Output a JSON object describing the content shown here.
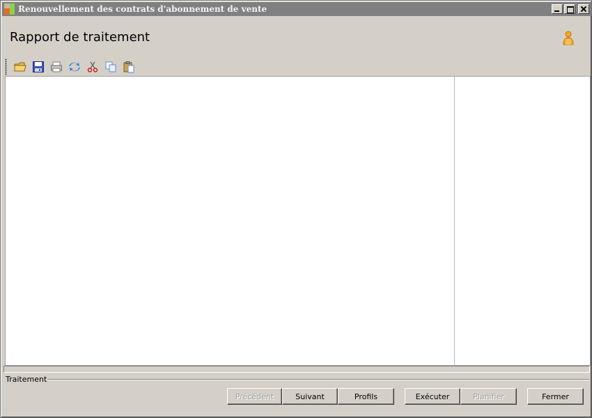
{
  "window": {
    "title": "Renouvellement des contrats d'abonnement de vente"
  },
  "header": {
    "title": "Rapport de traitement"
  },
  "toolbar": {
    "icons": [
      "open-folder-icon",
      "save-icon",
      "print-icon",
      "refresh-icon",
      "cut-icon",
      "copy-icon",
      "paste-icon"
    ]
  },
  "group": {
    "label": "Traitement"
  },
  "buttons": {
    "previous": {
      "label": "Précédent",
      "enabled": false
    },
    "next": {
      "label": "Suivant",
      "enabled": true
    },
    "profiles": {
      "label": "Profils",
      "enabled": true
    },
    "execute": {
      "label": "Exécuter",
      "enabled": true
    },
    "schedule": {
      "label": "Planifier",
      "enabled": false
    },
    "close": {
      "label": "Fermer",
      "enabled": true
    }
  },
  "colors": {
    "titlebar": "#808080",
    "window_bg": "#d4d0c8",
    "content_bg": "#ffffff"
  }
}
